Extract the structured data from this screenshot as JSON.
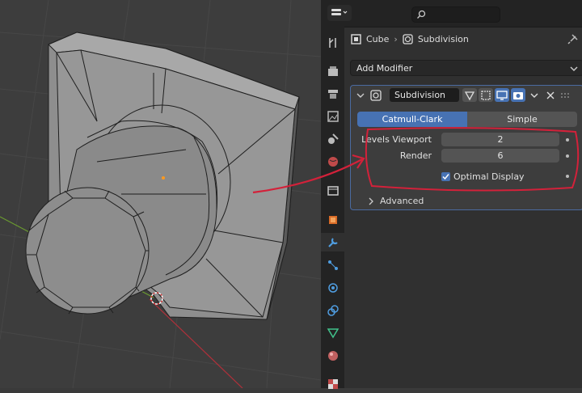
{
  "header": {
    "search_placeholder": ""
  },
  "breadcrumb": {
    "object": "Cube",
    "modifier": "Subdivision"
  },
  "add_modifier": {
    "label": "Add Modifier"
  },
  "modifier": {
    "name": "Subdivision",
    "algorithms": [
      "Catmull-Clark",
      "Simple"
    ],
    "selected_algorithm": "Catmull-Clark",
    "levels_viewport_label": "Levels Viewport",
    "levels_viewport_value": "2",
    "render_label": "Render",
    "render_value": "6",
    "optimal_display_label": "Optimal Display",
    "optimal_display_checked": true,
    "advanced_label": "Advanced"
  },
  "tabs": [
    "tool-icon",
    "render-icon",
    "output-icon",
    "view-layer-icon",
    "scene-icon",
    "world-icon",
    "collection-icon",
    "object-icon",
    "modifier-icon",
    "particles-icon",
    "physics-icon",
    "constraints-icon",
    "data-icon",
    "material-icon",
    "texture-icon"
  ],
  "colors": {
    "accent": "#4772b3",
    "annotation": "#d3213a"
  }
}
